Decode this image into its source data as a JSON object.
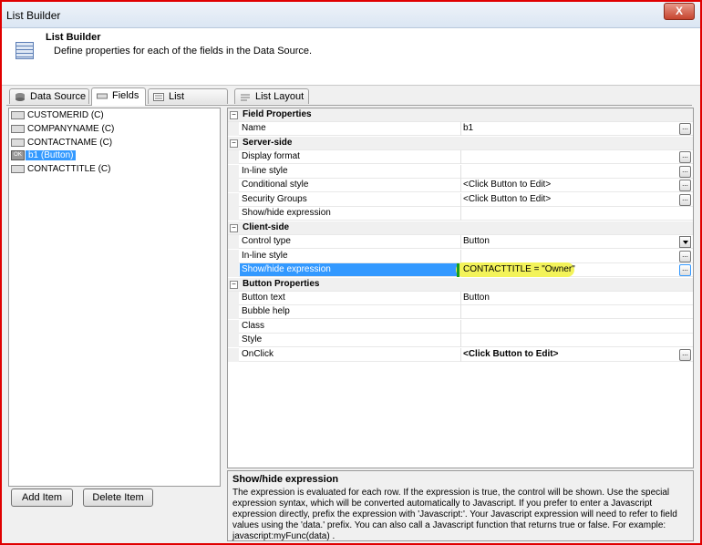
{
  "window": {
    "title": "List Builder",
    "close_glyph": "X"
  },
  "header": {
    "title": "List Builder",
    "subtitle": "Define properties for each of the fields in the Data Source."
  },
  "tabs": [
    {
      "label": "Data Source",
      "icon": "database-icon"
    },
    {
      "label": "Fields",
      "icon": "field-icon"
    },
    {
      "label": "List Properties",
      "icon": "properties-icon"
    },
    {
      "label": "List Layout",
      "icon": "layout-icon"
    }
  ],
  "active_tab": "Fields",
  "fields": [
    {
      "label": "CUSTOMERID (C)"
    },
    {
      "label": "COMPANYNAME (C)"
    },
    {
      "label": "CONTACTNAME (C)"
    },
    {
      "label": "b1 (Button)",
      "icon_text": "OK",
      "selected": true
    },
    {
      "label": "CONTACTTITLE (C)"
    }
  ],
  "buttons": {
    "add": "Add Item",
    "delete": "Delete Item"
  },
  "properties": {
    "cat1": "Field Properties",
    "name_k": "Name",
    "name_v": "b1",
    "cat2": "Server-side",
    "display_k": "Display format",
    "inline1_k": "In-line style",
    "cond_k": "Conditional style",
    "cond_v": "<Click Button to Edit>",
    "sec_k": "Security Groups",
    "sec_v": "<Click Button to Edit>",
    "showhide1_k": "Show/hide expression",
    "cat3": "Client-side",
    "ctrl_k": "Control type",
    "ctrl_v": "Button",
    "inline2_k": "In-line style",
    "showhide2_k": "Show/hide expression",
    "showhide2_v": "CONTACTTITLE = \"Owner\"",
    "cat4": "Button Properties",
    "btntext_k": "Button text",
    "btntext_v": "Button",
    "bubble_k": "Bubble help",
    "class_k": "Class",
    "style_k": "Style",
    "onclick_k": "OnClick",
    "onclick_v": "<Click Button to Edit>"
  },
  "ellipsis_glyph": "...",
  "collapse_glyph": "−",
  "help": {
    "title": "Show/hide expression",
    "body": "The expression is evaluated for each row. If the expression is true, the control will be shown. Use the special expression syntax, which will be converted automatically to Javascript. If you prefer to enter a Javascript expression directly, prefix the expression with 'Javascript:'. Your Javascript expression will need to refer to field values using the 'data.' prefix. You can also call a Javascript function that returns true or false. For example: javascript:myFunc(data) ."
  }
}
